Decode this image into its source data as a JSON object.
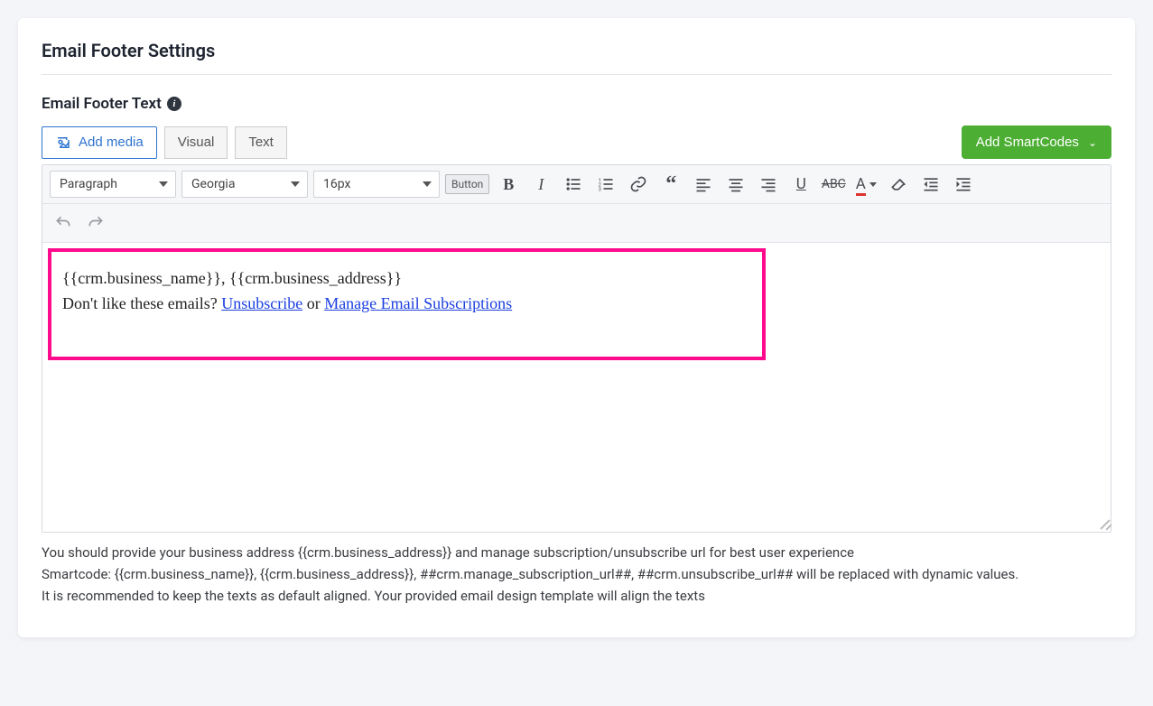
{
  "page_title": "Email Footer Settings",
  "section_label": "Email Footer Text",
  "buttons": {
    "add_media": "Add media",
    "visual_tab": "Visual",
    "text_tab": "Text",
    "add_smartcodes": "Add SmartCodes",
    "button_tool": "Button"
  },
  "toolbar": {
    "paragraph": "Paragraph",
    "font": "Georgia",
    "size": "16px"
  },
  "editor_content": {
    "line1": "{{crm.business_name}}, {{crm.business_address}}",
    "line2_pre": "Don't like these emails? ",
    "unsubscribe": "Unsubscribe",
    "or": " or ",
    "manage": "Manage Email Subscriptions"
  },
  "help": {
    "line1": "You should provide your business address {{crm.business_address}} and manage subscription/unsubscribe url for best user experience",
    "line2": "Smartcode: {{crm.business_name}}, {{crm.business_address}}, ##crm.manage_subscription_url##, ##crm.unsubscribe_url## will be replaced with dynamic values.",
    "line3": "It is recommended to keep the texts as default aligned. Your provided email design template will align the texts"
  },
  "icon_titles": {
    "bold": "Bold",
    "italic": "Italic",
    "ul": "Bulleted list",
    "ol": "Numbered list",
    "link": "Link",
    "blockquote": "Blockquote",
    "alignleft": "Align left",
    "aligncenter": "Align center",
    "alignright": "Align right",
    "underline": "Underline",
    "strike": "Strikethrough",
    "textcolor": "Text color",
    "clear": "Clear formatting",
    "outdent": "Outdent",
    "indent": "Indent",
    "undo": "Undo",
    "redo": "Redo"
  }
}
